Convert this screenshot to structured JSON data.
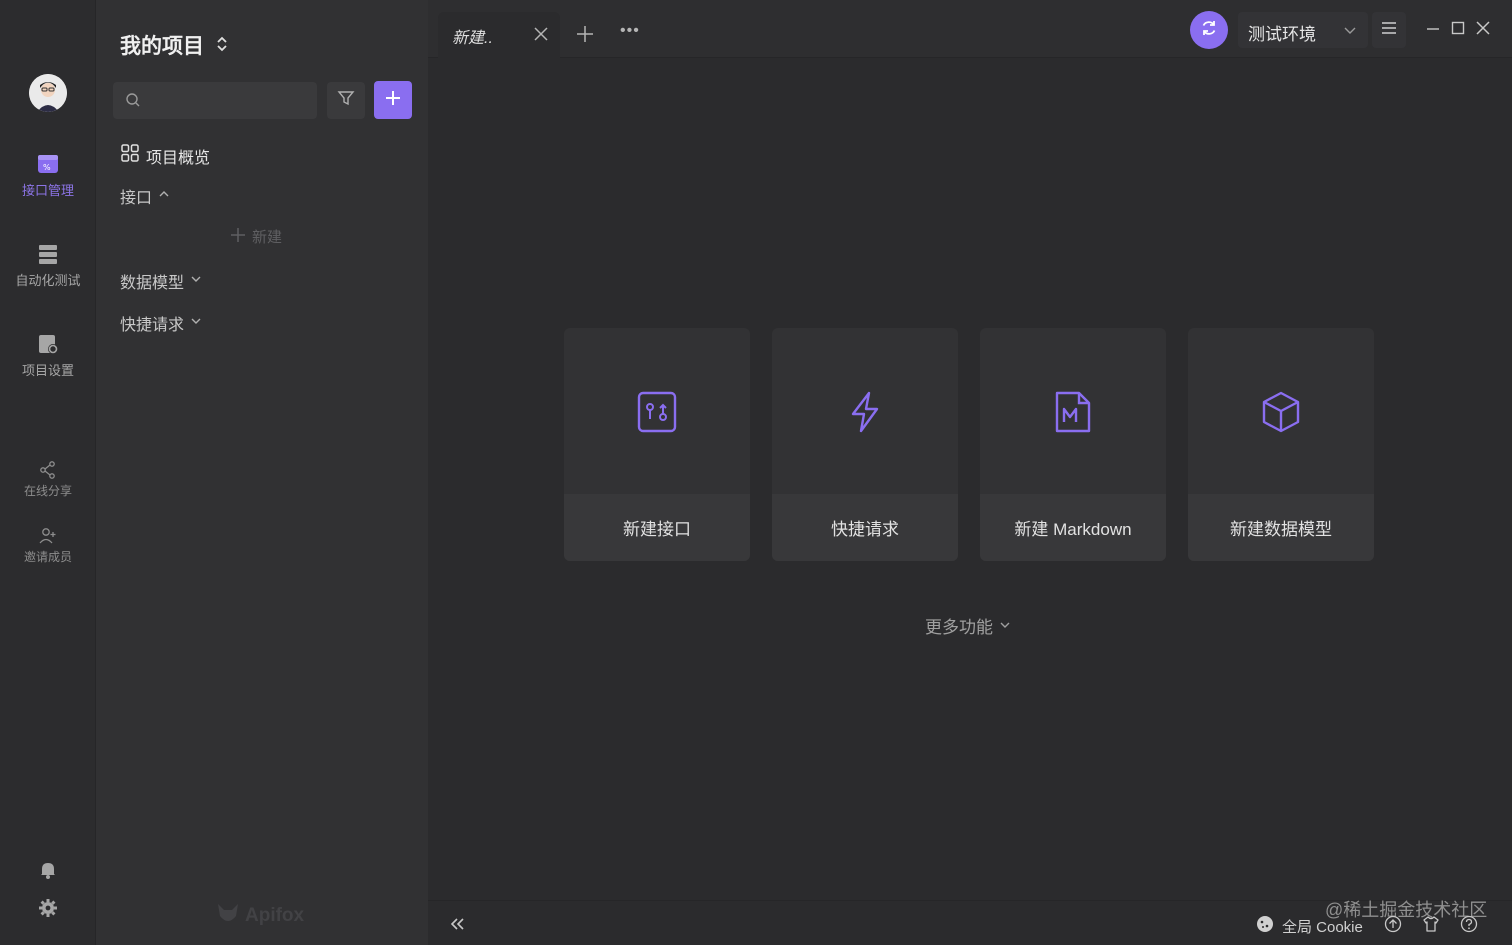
{
  "rail": {
    "items": [
      {
        "label": "接口管理",
        "icon": "api-manage-icon",
        "active": true
      },
      {
        "label": "自动化测试",
        "icon": "automation-test-icon",
        "active": false
      },
      {
        "label": "项目设置",
        "icon": "project-settings-icon",
        "active": false
      }
    ],
    "small_items": [
      {
        "label": "在线分享",
        "icon": "share-icon"
      },
      {
        "label": "邀请成员",
        "icon": "invite-member-icon"
      }
    ],
    "bottom_icons": [
      "bell-icon",
      "settings-gear-icon"
    ]
  },
  "sidebar": {
    "project_title": "我的项目",
    "overview_label": "项目概览",
    "api_label": "接口",
    "new_label": "新建",
    "data_model_label": "数据模型",
    "quick_request_label": "快捷请求",
    "brand": "Apifox"
  },
  "tabs": [
    {
      "label": "新建..",
      "active": true
    }
  ],
  "environment": {
    "selected": "测试环境"
  },
  "main": {
    "cards": [
      {
        "label": "新建接口",
        "icon": "api-card-icon"
      },
      {
        "label": "快捷请求",
        "icon": "lightning-icon"
      },
      {
        "label": "新建 Markdown",
        "icon": "markdown-file-icon"
      },
      {
        "label": "新建数据模型",
        "icon": "cube-icon"
      }
    ],
    "more_label": "更多功能"
  },
  "bottombar": {
    "cookie_label": "全局 Cookie",
    "watermark": "@稀土掘金技术社区"
  },
  "colors": {
    "accent": "#8a6ef0",
    "background": "#2b2b2d",
    "sidebar": "#313133"
  }
}
